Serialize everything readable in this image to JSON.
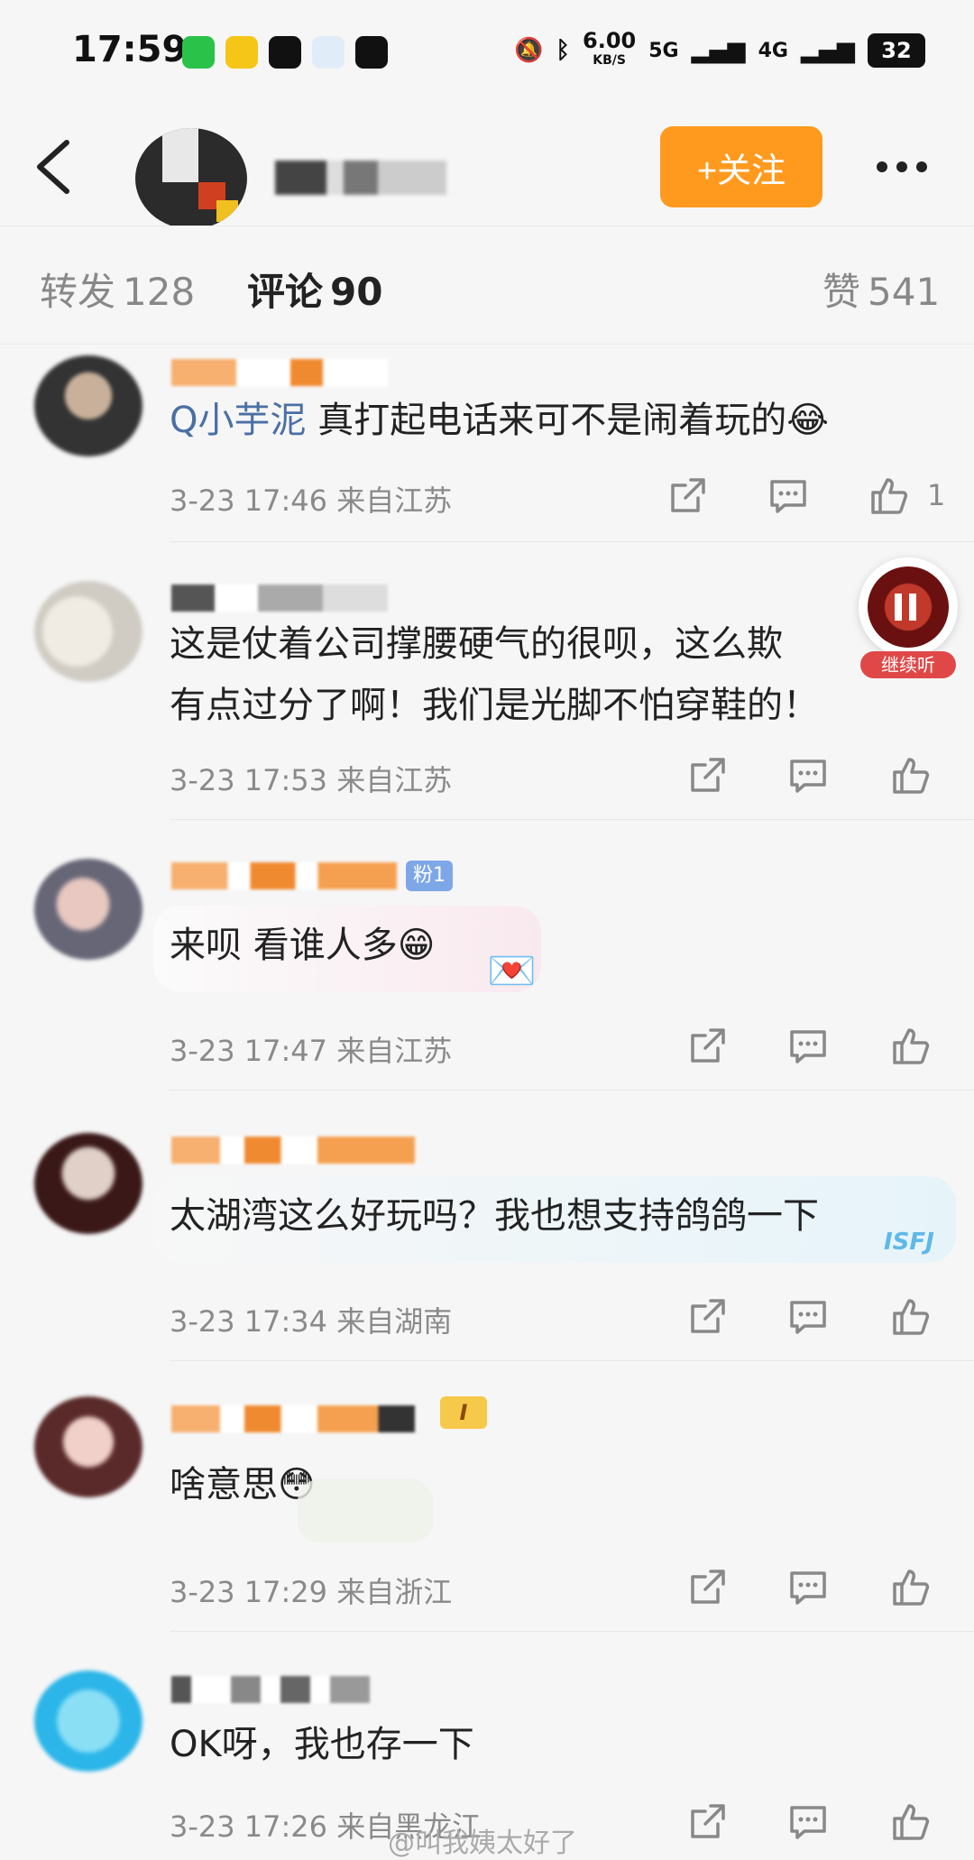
{
  "status_bar": {
    "time": "17:59",
    "app_icons": [
      "wechat-icon",
      "weibo-icon",
      "tiktok-icon",
      "qq-browser-icon",
      "tiktok-icon"
    ],
    "net_speed_value": "6.00",
    "net_speed_unit": "KB/S",
    "network_1": "5G",
    "network_2": "4G",
    "battery": "32"
  },
  "header": {
    "follow_label": "+关注"
  },
  "tabs": {
    "reposts_label": "转发",
    "reposts_count": "128",
    "comments_label": "评论",
    "comments_count": "90",
    "likes_label": "赞",
    "likes_count": "541"
  },
  "comments": [
    {
      "mention": "Q小芋泥",
      "text": "真打起电话来可不是闹着玩的",
      "emoji": "😂",
      "time": "3-23 17:46",
      "location": "来自江苏",
      "like_count": "1"
    },
    {
      "text_line1": "这是仗着公司撑腰硬气的很呗，这么欺",
      "text_line2": "有点过分了啊！我们是光脚不怕穿鞋的！",
      "time": "3-23 17:53",
      "location": "来自江苏"
    },
    {
      "badge": "粉1",
      "text": "来呗 看谁人多",
      "emoji": "😁",
      "time": "3-23 17:47",
      "location": "来自江苏"
    },
    {
      "text": "太湖湾这么好玩吗？我也想支持鸽鸽一下",
      "bubble_sticker": "ISFJ",
      "time": "3-23 17:34",
      "location": "来自湖南"
    },
    {
      "badge": "I",
      "text": "啥意思",
      "emoji": "😳",
      "time": "3-23 17:29",
      "location": "来自浙江"
    },
    {
      "text": "OK呀，我也存一下",
      "time": "3-23 17:26",
      "location": "来自黑龙江"
    }
  ],
  "float_player": {
    "label": "继续听"
  },
  "watermark": "@叫我姨太好了",
  "colors": {
    "accent": "#ff9a1f",
    "mention": "#4a6fa5",
    "meta": "#8a8a8a"
  }
}
